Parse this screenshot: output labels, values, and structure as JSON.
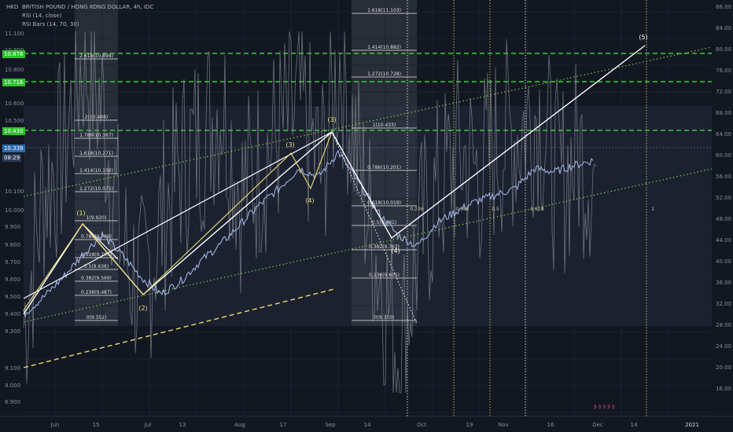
{
  "header": {
    "currency": "HKD",
    "title": "BRITISH POUND / HONG KONG DOLLAR, 4h, IDC",
    "indicator1": "RSI (14, close)",
    "indicator2": "RSI Bars (14, 70, 30)"
  },
  "left_axis": {
    "ticks": [
      "11.100",
      "10.900",
      "10.800",
      "10.600",
      "10.500",
      "10.100",
      "10.000",
      "9.900",
      "9.800",
      "9.700",
      "9.600",
      "9.500",
      "9.400",
      "9.300",
      "9.100",
      "9.000",
      "8.900"
    ],
    "tags": [
      {
        "label": "10.876",
        "color": "#2fbf2f"
      },
      {
        "label": "10.716",
        "color": "#2fbf2f"
      },
      {
        "label": "10.430",
        "color": "#2fbf2f"
      },
      {
        "label": "10.339",
        "color": "#2b6cb0"
      },
      {
        "label": "08:29",
        "color": "#2b3a55"
      }
    ]
  },
  "right_axis": {
    "ticks": [
      "88.00",
      "84.00",
      "80.00",
      "76.00",
      "72.00",
      "68.00",
      "64.00",
      "60.00",
      "56.00",
      "52.00",
      "48.00",
      "44.00",
      "40.00",
      "36.00",
      "32.00",
      "28.00",
      "24.00",
      "20.00",
      "16.00"
    ]
  },
  "x_axis": {
    "ticks": [
      "Jun",
      "15",
      "Jul",
      "13",
      "Aug",
      "17",
      "Sep",
      "14",
      "Oct",
      "19",
      "Nov",
      "16",
      "Dec",
      "14",
      "2021"
    ]
  },
  "fib_levels": {
    "left": [
      "2.618(10.899)",
      "2(10.488)",
      "1.786(10.367)",
      "1.618(10.271)",
      "1.414(10.156)",
      "1.272(10.075)",
      "1(9.920)",
      "0.786(9.799)",
      "0.618(9.704)",
      "0.5(9.636)",
      "0.382(9.569)",
      "0.236(9.487)",
      "0(9.352)"
    ],
    "right": [
      "1.618(11.103)",
      "1.414(10.882)",
      "1.272(10.728)",
      "1(10.433)",
      "0.786(10.201)",
      "0.618(10.019)",
      "0.5(9.891)",
      "0.382(9.763)",
      "0.236(9.605)",
      "0(9.350)"
    ]
  },
  "wave_labels": [
    "(1)",
    "(2)",
    "(3)",
    "(4)",
    "(3)",
    "(4)",
    "(5)"
  ],
  "misc_labels": [
    "0.236",
    "0.382",
    "0.5",
    "0.618",
    "1"
  ],
  "bars_labels": "3 3 3 3 3",
  "chart_data": {
    "type": "line",
    "title": "BRITISH POUND / HONG KONG DOLLAR, 4h, IDC",
    "series": [
      {
        "name": "BRITISH POUND / HONG KONG DOLLAR",
        "values": [
          9.4,
          9.5,
          9.62,
          9.76,
          9.88,
          9.76,
          9.62,
          9.52,
          9.6,
          9.72,
          9.82,
          9.94,
          10.06,
          10.16,
          10.28,
          10.23,
          10.38,
          10.2,
          10.02,
          9.88,
          9.81,
          9.95,
          10.02,
          10.08,
          10.12,
          10.16,
          10.28,
          10.26,
          10.3,
          10.33
        ]
      },
      {
        "name": "RSI (14, close)",
        "values": [
          30,
          55,
          62,
          80,
          70,
          44,
          36,
          50,
          60,
          65,
          72,
          54,
          60,
          66,
          70,
          58,
          80,
          58,
          40,
          25,
          46,
          55,
          62,
          58,
          64,
          66,
          70,
          56,
          62,
          58
        ]
      }
    ],
    "ylim": [
      8.85,
      11.15
    ],
    "rsi_ylim": [
      14,
      90
    ],
    "rsi_bands": [
      30,
      70
    ]
  }
}
